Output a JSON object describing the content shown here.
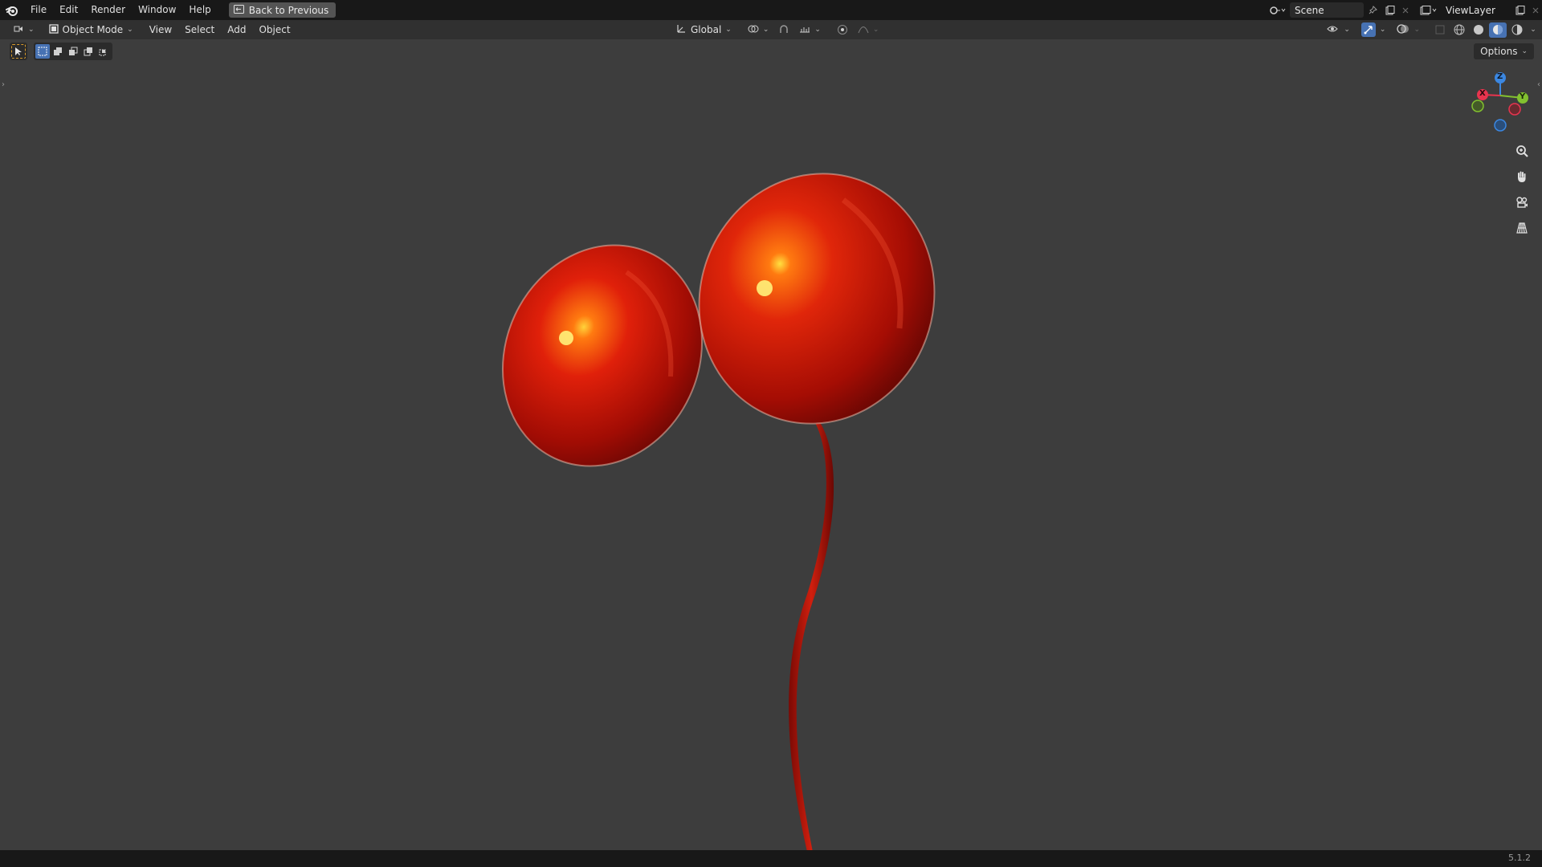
{
  "topbar": {
    "menus": [
      "File",
      "Edit",
      "Render",
      "Window",
      "Help"
    ],
    "back_label": "Back to Previous",
    "scene_name": "Scene",
    "view_layer": "ViewLayer"
  },
  "header": {
    "mode": "Object Mode",
    "menus": [
      "View",
      "Select",
      "Add",
      "Object"
    ],
    "transform_orientation": "Global"
  },
  "toolbar": {
    "options_label": "Options"
  },
  "gizmo": {
    "x_label": "X",
    "y_label": "Y",
    "z_label": "Z",
    "x_color": "#e8344e",
    "y_color": "#82c12f",
    "z_color": "#3b87e1"
  },
  "status": {
    "version": "5.1.2"
  },
  "colors": {
    "balloon": "#c81e0a",
    "ribbon": "#a8140a",
    "viewport_bg": "#3d3d3d"
  }
}
